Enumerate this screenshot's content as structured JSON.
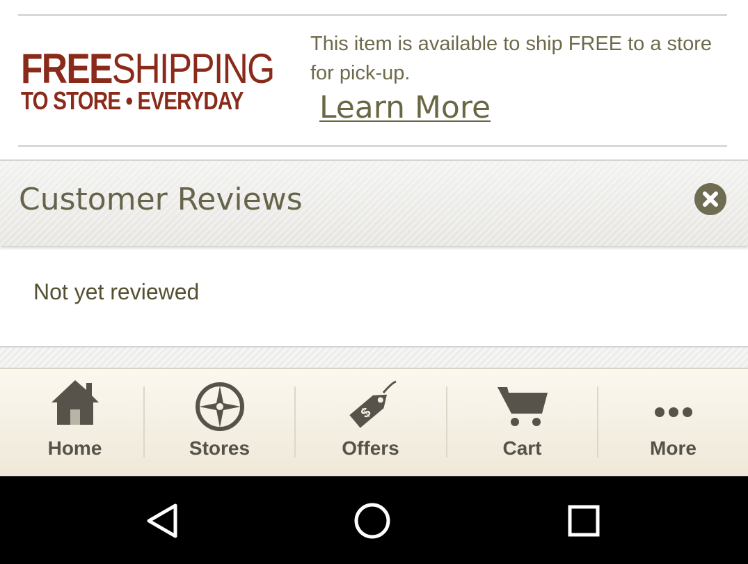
{
  "promo": {
    "logo_free": "FREE",
    "logo_shipping": "SHIPPING",
    "logo_line2": "TO STORE • EVERYDAY",
    "description": "This item is available to ship FREE to a store for pick-up.",
    "learn_more": "Learn More"
  },
  "reviews": {
    "title": "Customer Reviews",
    "empty_message": "Not yet reviewed",
    "close_icon": "close-icon"
  },
  "tabbar": {
    "tabs": [
      {
        "label": "Home",
        "icon": "home-icon"
      },
      {
        "label": "Stores",
        "icon": "compass-icon"
      },
      {
        "label": "Offers",
        "icon": "price-tag-icon"
      },
      {
        "label": "Cart",
        "icon": "cart-icon"
      },
      {
        "label": "More",
        "icon": "more-dots-icon"
      }
    ]
  },
  "system_nav": {
    "back_icon": "back-icon",
    "home_icon": "home-circle-icon",
    "recents_icon": "recents-icon"
  },
  "colors": {
    "brand_red": "#8a2a1a",
    "olive_text": "#6d6a4a",
    "icon_dark": "#57534b"
  }
}
